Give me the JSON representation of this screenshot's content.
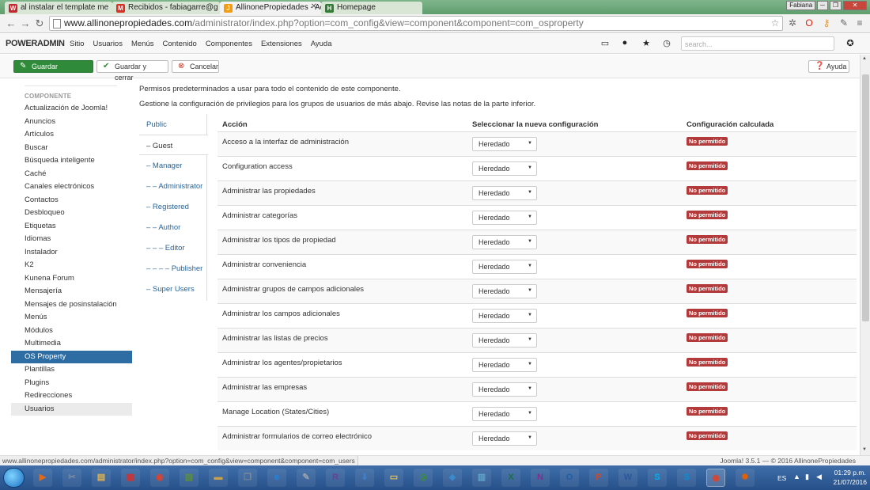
{
  "browser": {
    "tabs": [
      {
        "label": "al instalar el template me",
        "icon": "wix-icon",
        "color": "#c1272d",
        "fav": "W"
      },
      {
        "label": "Recibidos - fabiagarre@g",
        "icon": "gmail-icon",
        "color": "#d93025",
        "fav": "M"
      },
      {
        "label": "AllinonePropiedades - Ad",
        "icon": "joomla-icon",
        "color": "#f39c12",
        "fav": "J"
      },
      {
        "label": "Homepage",
        "icon": "homepage-icon",
        "color": "#2e7d32",
        "fav": "H"
      }
    ],
    "user_label": "Fabiana",
    "url_host": "www.allinonepropiedades.com",
    "url_path": "/administrator/index.php?option=com_config&view=component&component=com_osproperty"
  },
  "admin": {
    "brand": "POWERADMIN",
    "menu": [
      "Sitio",
      "Usuarios",
      "Menús",
      "Contenido",
      "Componentes",
      "Extensiones",
      "Ayuda"
    ],
    "search_placeholder": "search..."
  },
  "toolbar": {
    "save": "Guardar",
    "save_close": "Guardar y cerrar",
    "cancel": "Cancelar",
    "help": "Ayuda"
  },
  "sidebar": {
    "title": "COMPONENTE",
    "items": [
      "Actualización de Joomla!",
      "Anuncios",
      "Artículos",
      "Buscar",
      "Búsqueda inteligente",
      "Caché",
      "Canales electrónicos",
      "Contactos",
      "Desbloqueo",
      "Etiquetas",
      "Idiomas",
      "Instalador",
      "K2",
      "Kunena Forum",
      "Mensajería",
      "Mensajes de posinstalación",
      "Menús",
      "Módulos",
      "Multimedia",
      "OS Property",
      "Plantillas",
      "Plugins",
      "Redirecciones",
      "Usuarios"
    ],
    "active_index": 19
  },
  "intro": {
    "line1": "Permisos predeterminados a usar para todo el contenido de este componente.",
    "line2": "Gestione la configuración de privilegios para los grupos de usuarios de más abajo. Revise las notas de la parte inferior."
  },
  "groups": [
    "Public",
    "– Guest",
    "– Manager",
    "– – Administrator",
    "– Registered",
    "– – Author",
    "– – – Editor",
    "– – – – Publisher",
    "– Super Users"
  ],
  "table": {
    "headers": {
      "action": "Acción",
      "select": "Seleccionar la nueva configuración",
      "calc": "Configuración calculada"
    },
    "select_value": "Heredado",
    "status": "No permitido",
    "status_color": "#b33a3a",
    "rows": [
      "Acceso a la interfaz de administración",
      "Configuration access",
      "Administrar las propiedades",
      "Administrar categorías",
      "Administrar los tipos de propiedad",
      "Administrar conveniencia",
      "Administrar grupos de campos adicionales",
      "Administrar los campos adicionales",
      "Administrar las listas de precios",
      "Administrar los agentes/propietarios",
      "Administrar las empresas",
      "Manage Location (States/Cities)",
      "Administrar formularios de correo electrónico"
    ]
  },
  "status": {
    "url": "www.allinonepropiedades.com/administrator/index.php?option=com_config&view=component&component=com_users",
    "footer": "Joomla! 3.5.1 — © 2016 AllinonePropiedades"
  },
  "taskbar": {
    "lang": "ES",
    "time": "01:29 p.m.",
    "date": "21/07/2016",
    "apps": [
      {
        "name": "media-player-icon",
        "label": "▶",
        "color": "#e06a1b"
      },
      {
        "name": "tools-icon",
        "label": "✂",
        "color": "#7a8ca5"
      },
      {
        "name": "explorer-icon",
        "label": "▤",
        "color": "#e3b34a"
      },
      {
        "name": "grid-app-icon",
        "label": "▦",
        "color": "#cc3333"
      },
      {
        "name": "chrome-icon",
        "label": "◉",
        "color": "#d9432f"
      },
      {
        "name": "pad-icon",
        "label": "▧",
        "color": "#5a8f3a"
      },
      {
        "name": "package-icon",
        "label": "▬",
        "color": "#c8a146"
      },
      {
        "name": "copy-icon",
        "label": "❐",
        "color": "#7d8b99"
      },
      {
        "name": "ie-icon",
        "label": "e",
        "color": "#1e88e5"
      },
      {
        "name": "notepad-icon",
        "label": "✎",
        "color": "#9aa3ad"
      },
      {
        "name": "winrar-icon",
        "label": "R",
        "color": "#6b3f8f"
      },
      {
        "name": "installer-icon",
        "label": "⬇",
        "color": "#3f7fc7"
      },
      {
        "name": "folder-icon",
        "label": "▭",
        "color": "#e3c35a"
      },
      {
        "name": "eye-icon",
        "label": "◎",
        "color": "#3c8d3c"
      },
      {
        "name": "network-icon",
        "label": "◈",
        "color": "#3a8ccf"
      },
      {
        "name": "map-icon",
        "label": "▥",
        "color": "#5fa3c9"
      },
      {
        "name": "excel-icon",
        "label": "X",
        "color": "#1d6f42"
      },
      {
        "name": "onenote-icon",
        "label": "N",
        "color": "#7b2f8f"
      },
      {
        "name": "outlook-icon",
        "label": "O",
        "color": "#1f5fa8"
      },
      {
        "name": "powerpoint-icon",
        "label": "P",
        "color": "#d24726"
      },
      {
        "name": "word-icon",
        "label": "W",
        "color": "#2b579a"
      },
      {
        "name": "skype-icon",
        "label": "S",
        "color": "#00aff0"
      },
      {
        "name": "skype2-icon",
        "label": "S",
        "color": "#0a8fd6"
      },
      {
        "name": "chrome-open-icon",
        "label": "◉",
        "color": "#d9432f"
      },
      {
        "name": "firefox-icon",
        "label": "✹",
        "color": "#e66000"
      }
    ]
  }
}
